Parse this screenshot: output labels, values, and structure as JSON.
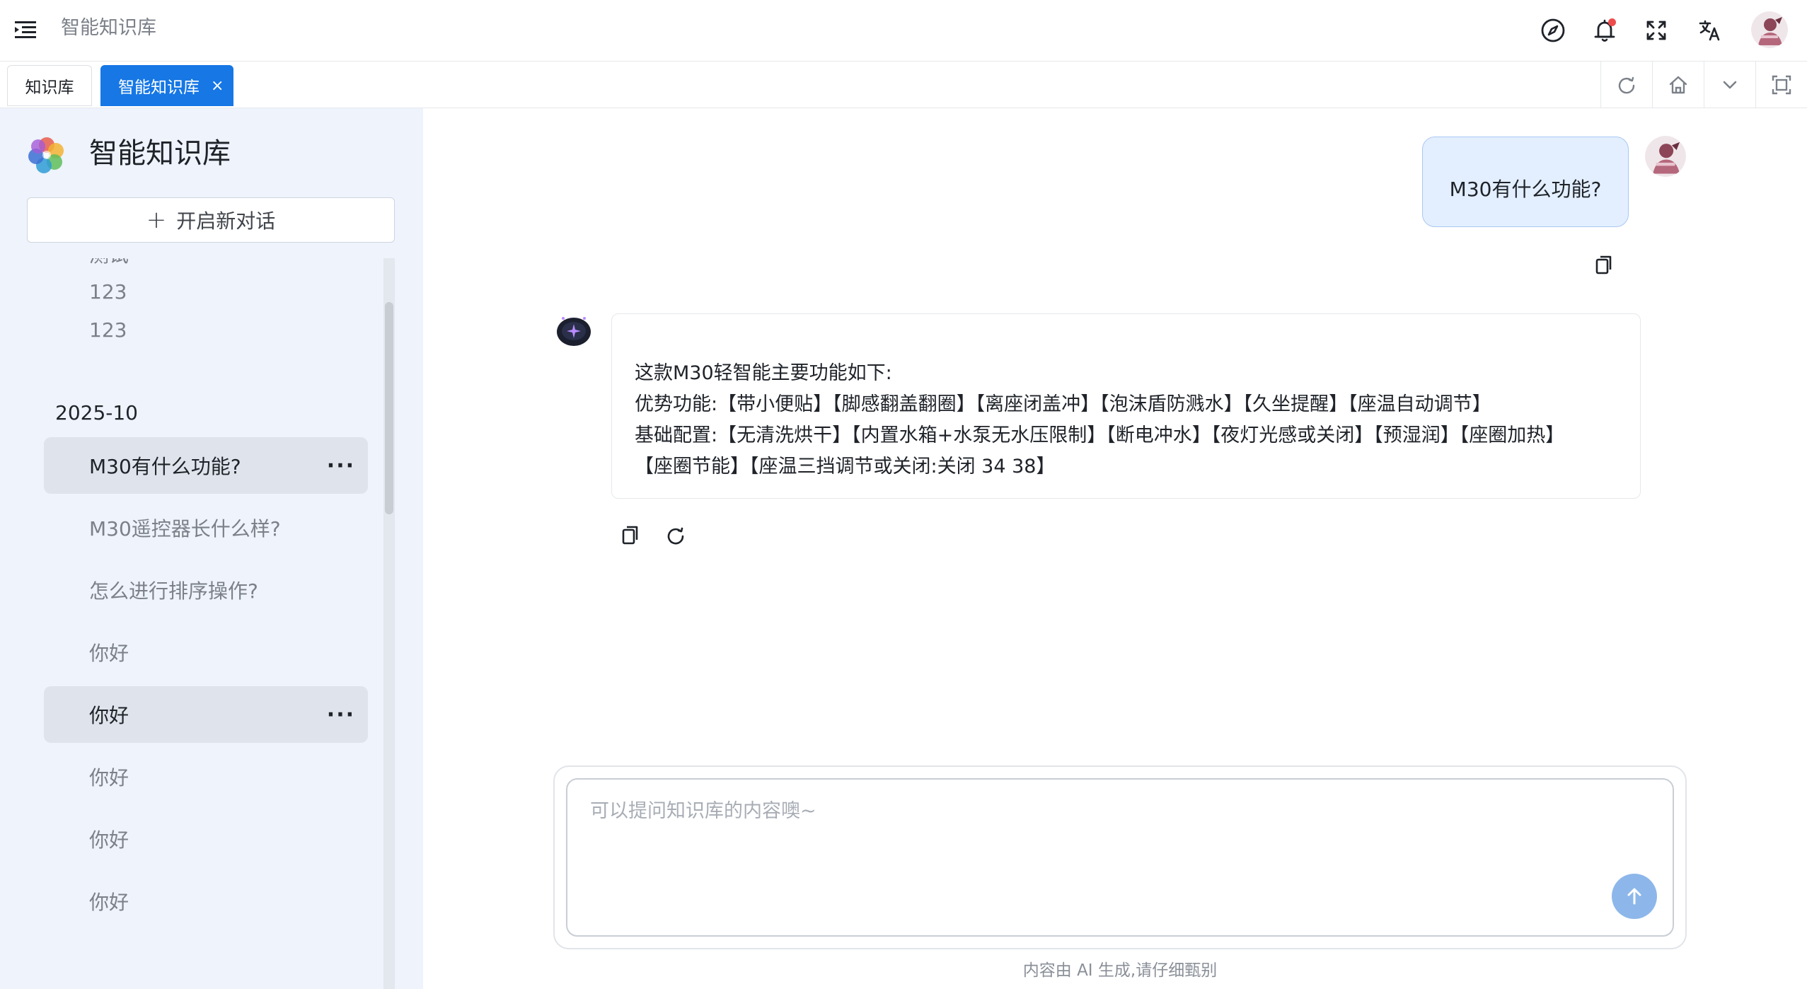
{
  "header": {
    "breadcrumb": "智能知识库"
  },
  "tabs": [
    {
      "label": "知识库"
    },
    {
      "label": "智能知识库",
      "close": "×"
    }
  ],
  "sidebar": {
    "title": "智能知识库",
    "new_chat": {
      "icon": "+",
      "label": "开启新对话"
    },
    "history_before": [
      {
        "label": "测试"
      },
      {
        "label": "123"
      },
      {
        "label": "123"
      }
    ],
    "group_label": "2025-10",
    "history_after": [
      {
        "label": "M30有什么功能?",
        "more": "···"
      },
      {
        "label": "M30遥控器长什么样?"
      },
      {
        "label": "怎么进行排序操作?"
      },
      {
        "label": "你好"
      },
      {
        "label": "你好",
        "more": "···"
      },
      {
        "label": "你好"
      },
      {
        "label": "你好"
      },
      {
        "label": "你好"
      }
    ]
  },
  "chat": {
    "user_message": "M30有什么功能?",
    "ai_lines": [
      "这款M30轻智能主要功能如下:",
      "优势功能:【带小便贴】【脚感翻盖翻圈】【离座闭盖冲】【泡沫盾防溅水】【久坐提醒】【座温自动调节】",
      "基础配置:【无清洗烘干】【内置水箱+水泵无水压限制】【断电冲水】【夜灯光感或关闭】【预湿润】【座圈加热】",
      "【座圈节能】【座温三挡调节或关闭:关闭 34 38】"
    ]
  },
  "input": {
    "placeholder": "可以提问知识库的内容噢~",
    "disclaimer": "内容由 AI 生成,请仔细甄别"
  },
  "colors": {
    "accent": "#1677e5",
    "sidebar_bg": "#eef3fc",
    "user_bubble": "#e3efff",
    "send_button": "#8db7ea"
  }
}
